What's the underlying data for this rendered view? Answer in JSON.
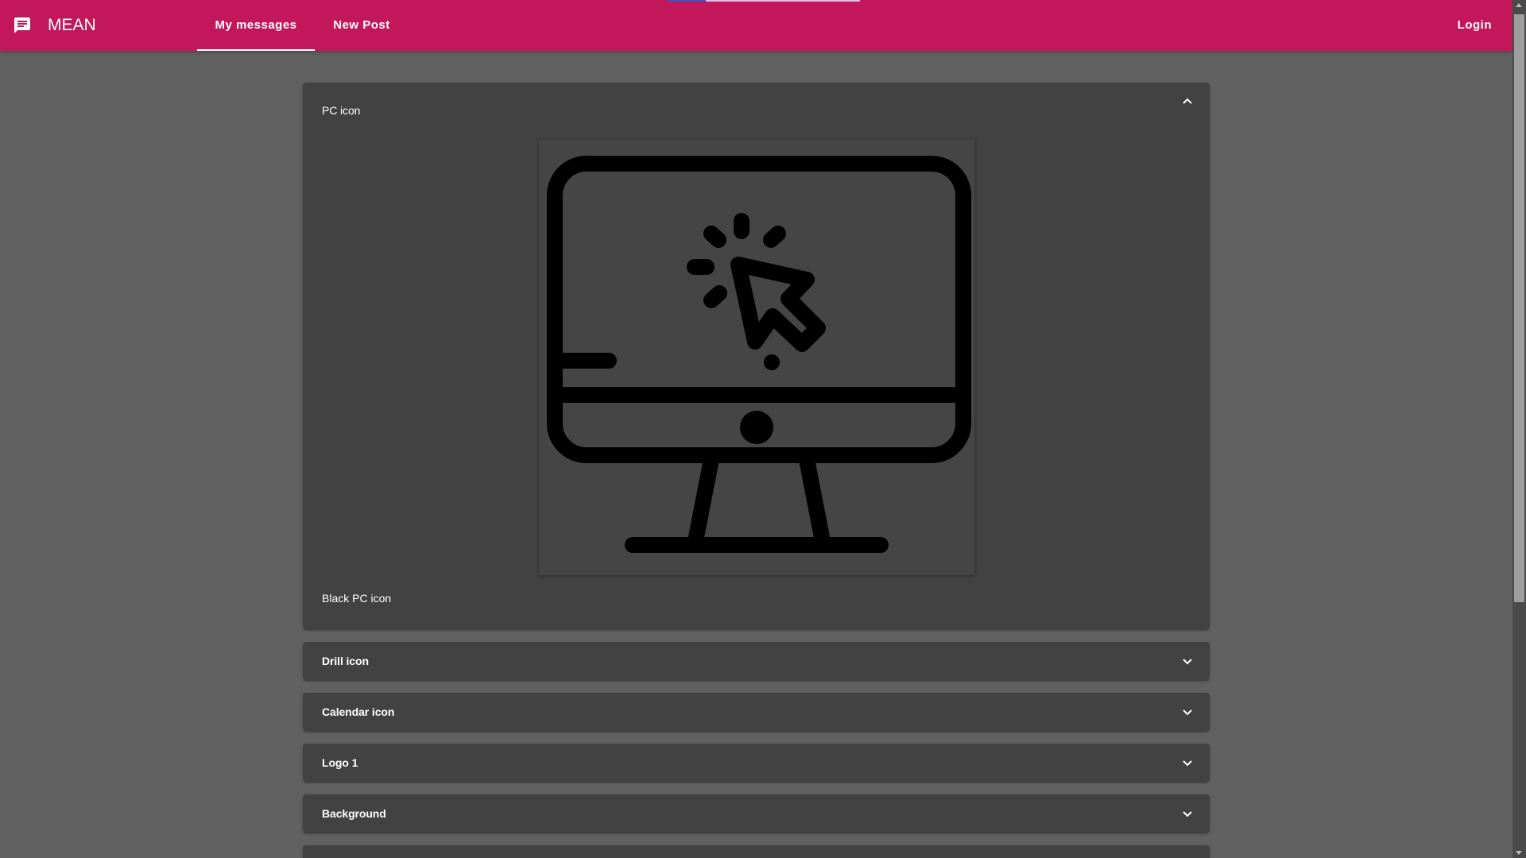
{
  "app": {
    "title": "MEAN",
    "brand_icon": "chat-message-icon"
  },
  "nav": {
    "tabs": [
      {
        "label": "My messages",
        "active": true
      },
      {
        "label": "New Post",
        "active": false
      }
    ],
    "login_label": "Login"
  },
  "posts": [
    {
      "title": "PC icon",
      "expanded": true,
      "image_icon": "desktop-computer-click-icon",
      "content": "Black PC icon"
    },
    {
      "title": "Drill icon",
      "expanded": false
    },
    {
      "title": "Calendar icon",
      "expanded": false
    },
    {
      "title": "Logo 1",
      "expanded": false
    },
    {
      "title": "Background",
      "expanded": false
    }
  ],
  "colors": {
    "primary": "#c2185b",
    "background": "#616161",
    "panel": "#424242",
    "text": "#ffffff"
  }
}
